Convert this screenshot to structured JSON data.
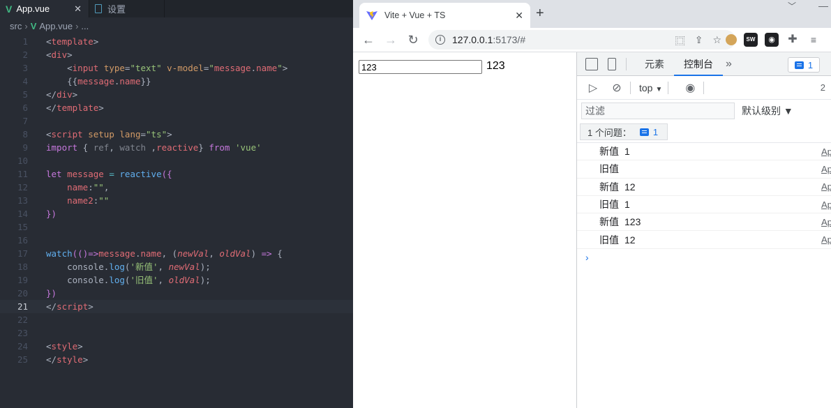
{
  "editor": {
    "tabs": [
      {
        "label": "App.vue",
        "close": "✕"
      },
      {
        "label": "设置"
      }
    ],
    "breadcrumb": {
      "folder": "src",
      "file": "App.vue",
      "tail": "..."
    },
    "current_line": 21,
    "lines": [
      {
        "n": "1"
      },
      {
        "n": "2"
      },
      {
        "n": "3"
      },
      {
        "n": "4"
      },
      {
        "n": "5"
      },
      {
        "n": "6"
      },
      {
        "n": "7"
      },
      {
        "n": "8"
      },
      {
        "n": "9"
      },
      {
        "n": "10"
      },
      {
        "n": "11"
      },
      {
        "n": "12"
      },
      {
        "n": "13"
      },
      {
        "n": "14"
      },
      {
        "n": "15"
      },
      {
        "n": "16"
      },
      {
        "n": "17"
      },
      {
        "n": "18"
      },
      {
        "n": "19"
      },
      {
        "n": "20"
      },
      {
        "n": "21"
      },
      {
        "n": "22"
      },
      {
        "n": "23"
      },
      {
        "n": "24"
      },
      {
        "n": "25"
      }
    ],
    "code": {
      "l1": {
        "a": "<",
        "b": "template",
        "c": ">"
      },
      "l2": {
        "a": "<",
        "b": "div",
        "c": ">"
      },
      "l3": {
        "a": "<",
        "b": "input",
        "c": " ",
        "d": "type",
        "e": "=",
        "f": "\"text\"",
        "g": " ",
        "h": "v-model",
        "i": "=",
        "j": "\"",
        "k": "message",
        "l": ".",
        "m": "name",
        "n": "\"",
        "o": ">"
      },
      "l4": {
        "a": "{{",
        "b": "message",
        "c": ".",
        "d": "name",
        "e": "}}"
      },
      "l5": {
        "a": "</",
        "b": "div",
        "c": ">"
      },
      "l6": {
        "a": "</",
        "b": "template",
        "c": ">"
      },
      "l8": {
        "a": "<",
        "b": "script",
        "c": " ",
        "d": "setup",
        "e": " ",
        "f": "lang",
        "g": "=",
        "h": "\"ts\"",
        "i": ">"
      },
      "l9": {
        "a": "import",
        "b": " { ",
        "c": "ref",
        "d": ", ",
        "e": "watch",
        "f": " ,",
        "g": "reactive",
        "h": "} ",
        "i": "from",
        "j": " ",
        "k": "'vue'"
      },
      "l11": {
        "a": "let",
        "b": " ",
        "c": "message",
        "d": " ",
        "e": "=",
        "f": " ",
        "g": "reactive",
        "h": "({"
      },
      "l12": {
        "a": "name",
        "b": ":",
        "c": "\"\"",
        "d": ","
      },
      "l13": {
        "a": "name2",
        "b": ":",
        "c": "\"\""
      },
      "l14": {
        "a": "})"
      },
      "l17": {
        "a": "watch",
        "b": "(()",
        "c": "=>",
        "d": "message",
        "e": ".",
        "f": "name",
        "g": ", (",
        "h": "newVal",
        "i": ", ",
        "j": "oldVal",
        "k": ") ",
        "l": "=>",
        "m": " {"
      },
      "l18": {
        "a": "console",
        "b": ".",
        "c": "log",
        "d": "(",
        "e": "'新值'",
        "f": ", ",
        "g": "newVal",
        "h": ");"
      },
      "l19": {
        "a": "console",
        "b": ".",
        "c": "log",
        "d": "(",
        "e": "'旧值'",
        "f": ", ",
        "g": "oldVal",
        "h": ");"
      },
      "l20": {
        "a": "})"
      },
      "l21": {
        "a": "</",
        "b": "script",
        "c": ">"
      },
      "l24": {
        "a": "<",
        "b": "style",
        "c": ">"
      },
      "l25": {
        "a": "</",
        "b": "style",
        "c": ">"
      }
    }
  },
  "browser": {
    "tab_title": "Vite + Vue + TS",
    "tab_close": "✕",
    "new_tab": "+",
    "url_host": "127.0.0.1",
    "url_path": ":5173/#",
    "page": {
      "input_value": "123",
      "echo": "123"
    }
  },
  "devtools": {
    "tabs": {
      "elements": "元素",
      "console": "控制台",
      "more": "»"
    },
    "issue_badge_count": "1",
    "context": "top",
    "filter_placeholder": "过滤",
    "levels": "默认级别",
    "level_caret": "▼",
    "hidden_count": "2",
    "issues_label": "1 个问题：",
    "issues_count": "1",
    "logs": [
      {
        "msg": "新值",
        "val": "1",
        "src": "Ap"
      },
      {
        "msg": "旧值",
        "val": "",
        "src": "Ap"
      },
      {
        "msg": "新值",
        "val": "12",
        "src": "Ap"
      },
      {
        "msg": "旧值",
        "val": "1",
        "src": "Ap"
      },
      {
        "msg": "新值",
        "val": "123",
        "src": "Ap"
      },
      {
        "msg": "旧值",
        "val": "12",
        "src": "Ap"
      }
    ],
    "prompt": "›"
  },
  "colors": {
    "vue_green": "#41b883",
    "accent_blue": "#1a73e8",
    "editor_bg": "#282c34"
  }
}
